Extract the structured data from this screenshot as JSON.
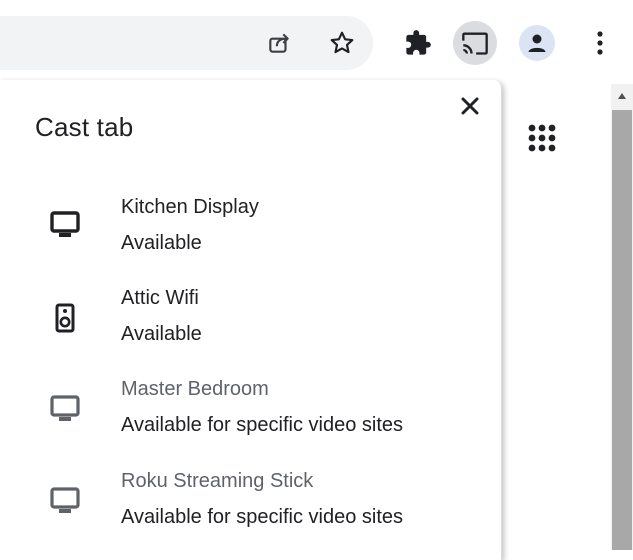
{
  "toolbar": {
    "icons": [
      "share-icon",
      "star-icon",
      "extensions-icon",
      "cast-icon",
      "profile-icon",
      "more-icon"
    ]
  },
  "cast_dialog": {
    "title": "Cast tab",
    "close_icon": "close-icon",
    "sinks": [
      {
        "name": "Kitchen Display",
        "status": "Available",
        "icon": "monitor-icon"
      },
      {
        "name": "Attic Wifi",
        "status": "Available",
        "icon": "speaker-icon"
      },
      {
        "name": "Master Bedroom",
        "status": "Available for specific video sites",
        "icon": "monitor-icon"
      },
      {
        "name": "Roku Streaming Stick",
        "status": "Available for specific video sites",
        "icon": "monitor-icon"
      }
    ]
  },
  "colors": {
    "accent_cast_bg": "#dadce0",
    "text_primary": "#202124",
    "text_secondary": "#5f6368"
  }
}
